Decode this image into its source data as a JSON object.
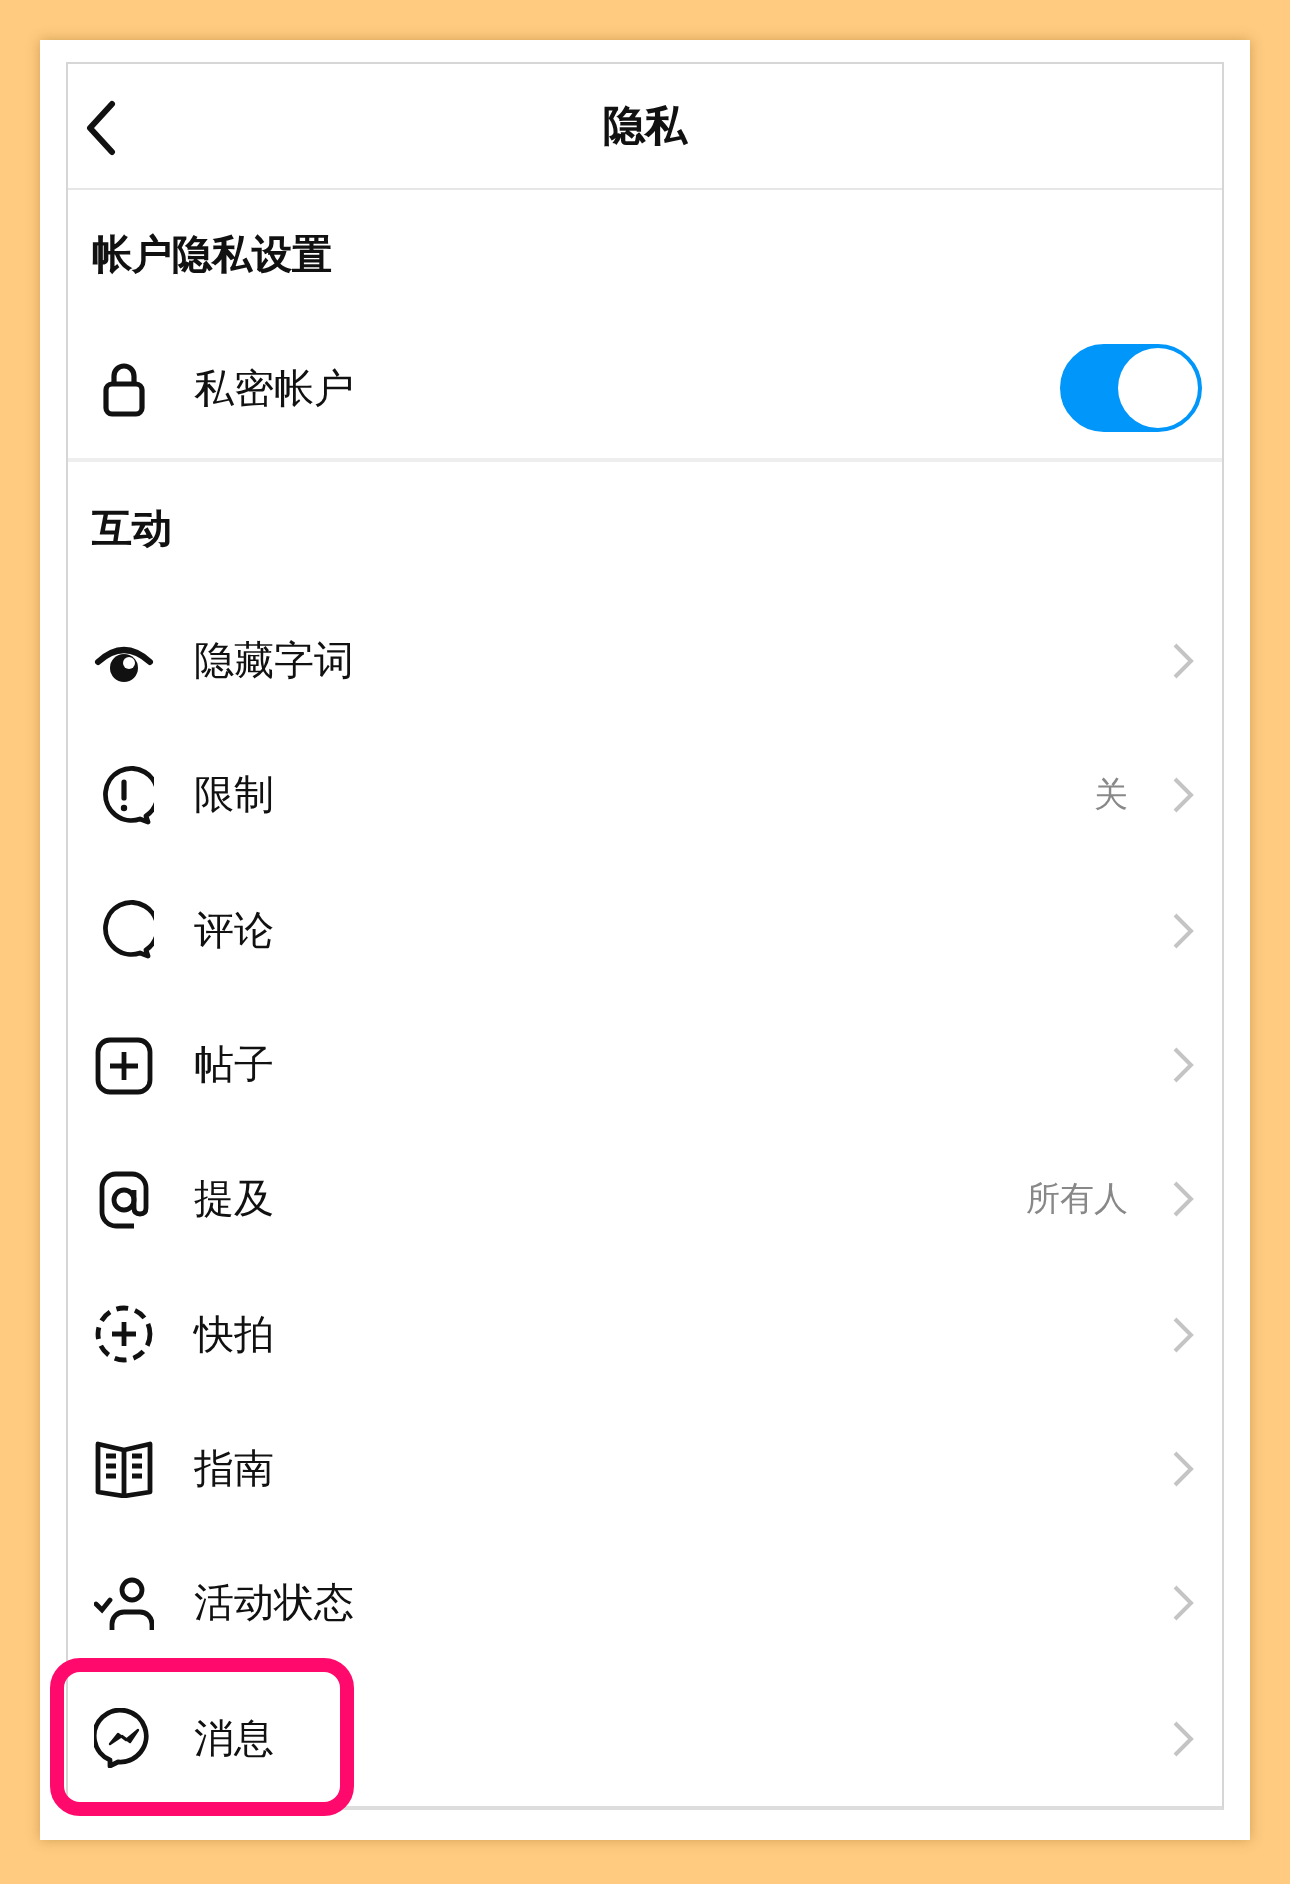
{
  "header": {
    "title": "隐私"
  },
  "account_section": {
    "heading": "帐户隐私设置",
    "private_account": {
      "label": "私密帐户",
      "on": true
    }
  },
  "interactions_section": {
    "heading": "互动",
    "items": [
      {
        "label": "隐藏字词",
        "highlighted": false
      },
      {
        "label": "限制",
        "value": "关",
        "highlighted": false
      },
      {
        "label": "评论",
        "highlighted": false
      },
      {
        "label": "帖子",
        "highlighted": false
      },
      {
        "label": "提及",
        "value": "所有人",
        "highlighted": false
      },
      {
        "label": "快拍",
        "highlighted": false
      },
      {
        "label": "指南",
        "highlighted": false
      },
      {
        "label": "活动状态",
        "highlighted": false
      },
      {
        "label": "消息",
        "highlighted": true
      }
    ]
  }
}
